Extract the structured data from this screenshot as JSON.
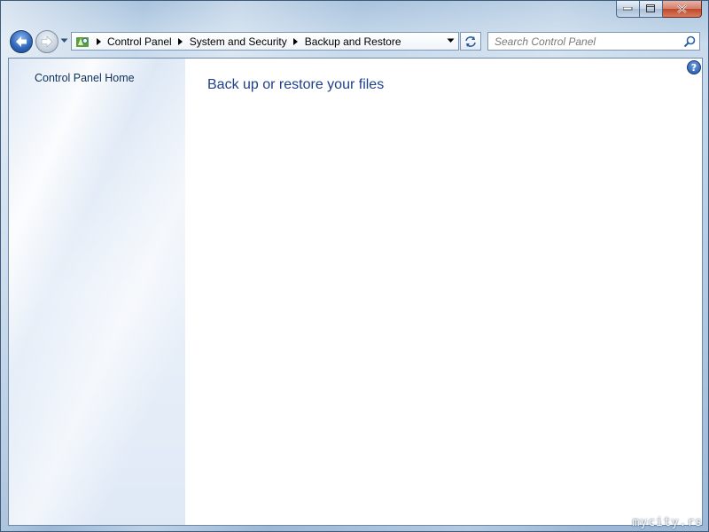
{
  "window": {
    "caption_buttons": [
      "minimize",
      "maximize",
      "close"
    ]
  },
  "navigation": {
    "back_icon": "back-arrow-icon",
    "forward_icon": "forward-arrow-icon",
    "breadcrumb": [
      "Control Panel",
      "System and Security",
      "Backup and Restore"
    ]
  },
  "search": {
    "placeholder": "Search Control Panel"
  },
  "sidebar": {
    "home_link": "Control Panel Home"
  },
  "main": {
    "title": "Back up or restore your files",
    "help_glyph": "?"
  },
  "watermark": "mycity.rs",
  "colors": {
    "link": "#0e2f5c",
    "title": "#1e3f8a",
    "close_button": "#c0472b"
  }
}
